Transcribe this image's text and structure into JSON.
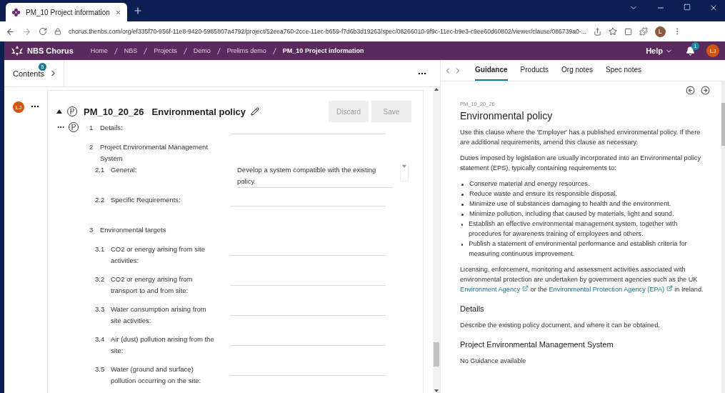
{
  "browser": {
    "tab_title": "PM_10 Project information",
    "url": "chorus.thenbs.com/org/ef335f70-956f-11e8-9420-5985807a4792/project/52eea760-2cce-11ec-b659-f7d6b3d19263/spec/08266010-9f9c-11ec-b9e3-c9ee60d60802/viewer/clause/086739a0-...",
    "profile_initial": "L"
  },
  "header": {
    "brand": "NBS Chorus",
    "breadcrumbs": [
      "Home",
      "NBS",
      "Projects",
      "Demo",
      "Prelims demo",
      "PM_10 Project information"
    ],
    "help": "Help",
    "notification_count": "1",
    "avatar": "LJ"
  },
  "contents": {
    "label": "Contents",
    "badge": "5"
  },
  "clause": {
    "avatar": "LJ",
    "code": "PM_10_20_26",
    "title": "Environmental policy",
    "buttons": [
      {
        "label": "Discard",
        "disabled": true
      },
      {
        "label": "Save",
        "disabled": true
      }
    ],
    "items": [
      {
        "kind": "field",
        "number": "1",
        "label": "Details:"
      },
      {
        "kind": "heading",
        "number": "2",
        "label": "Project Environmental Management System",
        "children": [
          {
            "kind": "field",
            "number": "2.1",
            "label": "General:",
            "value": "Develop a system compatible with the existing policy."
          },
          {
            "kind": "field",
            "number": "2.2",
            "label": "Specific Requirements:"
          }
        ]
      },
      {
        "kind": "heading",
        "number": "3",
        "label": "Environmental targets",
        "children": [
          {
            "kind": "field",
            "number": "3.1",
            "label": "CO2 or energy arising from site activities:"
          },
          {
            "kind": "field",
            "number": "3.2",
            "label": "CO2 or energy arising from transport to and from site:"
          },
          {
            "kind": "field",
            "number": "3.3",
            "label": "Water consumption arising from site activities:"
          },
          {
            "kind": "field",
            "number": "3.4",
            "label": "Air (dust) pollution arising from the site:"
          },
          {
            "kind": "field",
            "number": "3.5",
            "label": "Water (ground and surface) pollution occurring on the site:"
          }
        ]
      }
    ]
  },
  "side_tabs": [
    {
      "label": "Guidance",
      "selected": true
    },
    {
      "label": "Products",
      "selected": false
    },
    {
      "label": "Org notes",
      "selected": false
    },
    {
      "label": "Spec notes",
      "selected": false
    }
  ],
  "guidance": {
    "code": "PM_10_20_26",
    "title": "Environmental policy",
    "blocks": [
      {
        "kind": "paragraph",
        "parts": [
          {
            "kind": "text",
            "text": "Use this clause where the 'Employer' has a published environmental policy. If there are additional requirements, amend this clause as necessary."
          }
        ]
      },
      {
        "kind": "paragraph",
        "parts": [
          {
            "kind": "text",
            "text": "Duties imposed by legislation are usually incorporated into an Environmental policy statement (EPS), typically containing requirements to:"
          }
        ]
      },
      {
        "kind": "bullets",
        "items": [
          "Conserve material and energy resources.",
          "Reduce waste and ensure its responsible disposal.",
          "Minimize use of substances damaging to health and the environment.",
          "Minimize pollution, including that caused by materials, light and sound.",
          "Establish an effective environmental management system, together with procedures for awareness training of employees and others.",
          "Publish a statement of environmental performance and establish criteria for measuring continuous improvement."
        ]
      },
      {
        "kind": "paragraph",
        "parts": [
          {
            "kind": "text",
            "text": "Licensing, enforcement, monitoring and assessment activities associated with environmental protection are undertaken by government agencies such as the UK "
          },
          {
            "kind": "link",
            "text": "Environment Agency"
          },
          {
            "kind": "text",
            "text": " or the "
          },
          {
            "kind": "link",
            "text": "Environmental Protection Agency (EPA)"
          },
          {
            "kind": "text",
            "text": " in Ireland."
          }
        ]
      },
      {
        "kind": "heading",
        "text": "Details"
      },
      {
        "kind": "paragraph",
        "parts": [
          {
            "kind": "text",
            "text": "Describe the existing policy document, and where it can be obtained."
          }
        ]
      },
      {
        "kind": "heading",
        "text": "Project Environmental Management System"
      },
      {
        "kind": "paragraph",
        "parts": [
          {
            "kind": "text",
            "text": "No Guidance available"
          }
        ]
      }
    ]
  }
}
